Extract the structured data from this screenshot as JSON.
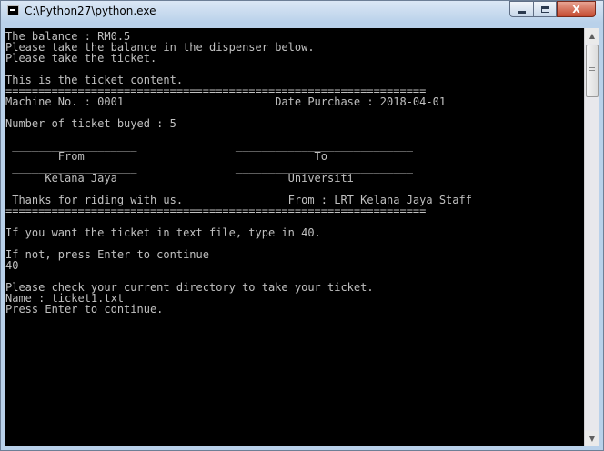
{
  "window": {
    "title": "C:\\Python27\\python.exe",
    "icon": "console-icon",
    "controls": {
      "minimize": "minimize-icon",
      "maximize": "maximize-icon",
      "close_label": "X"
    }
  },
  "console": {
    "lines": [
      "The balance : RM0.5",
      "Please take the balance in the dispenser below.",
      "Please take the ticket.",
      "",
      "This is the ticket content.",
      "================================================================",
      "Machine No. : 0001                       Date Purchase : 2018-04-01",
      "",
      "Number of ticket buyed : 5",
      "",
      " ___________________               ___________________________",
      "        From                                   To",
      " ___________________               ___________________________",
      "      Kelana Jaya                          Universiti",
      "",
      " Thanks for riding with us.                From : LRT Kelana Jaya Staff",
      "================================================================",
      "",
      "If you want the ticket in text file, type in 40.",
      "",
      "If not, press Enter to continue",
      "40",
      "",
      "Please check your current directory to take your ticket.",
      "Name : ticket1.txt",
      "Press Enter to continue."
    ]
  },
  "scrollbar": {
    "up_arrow": "▲",
    "down_arrow": "▼"
  }
}
